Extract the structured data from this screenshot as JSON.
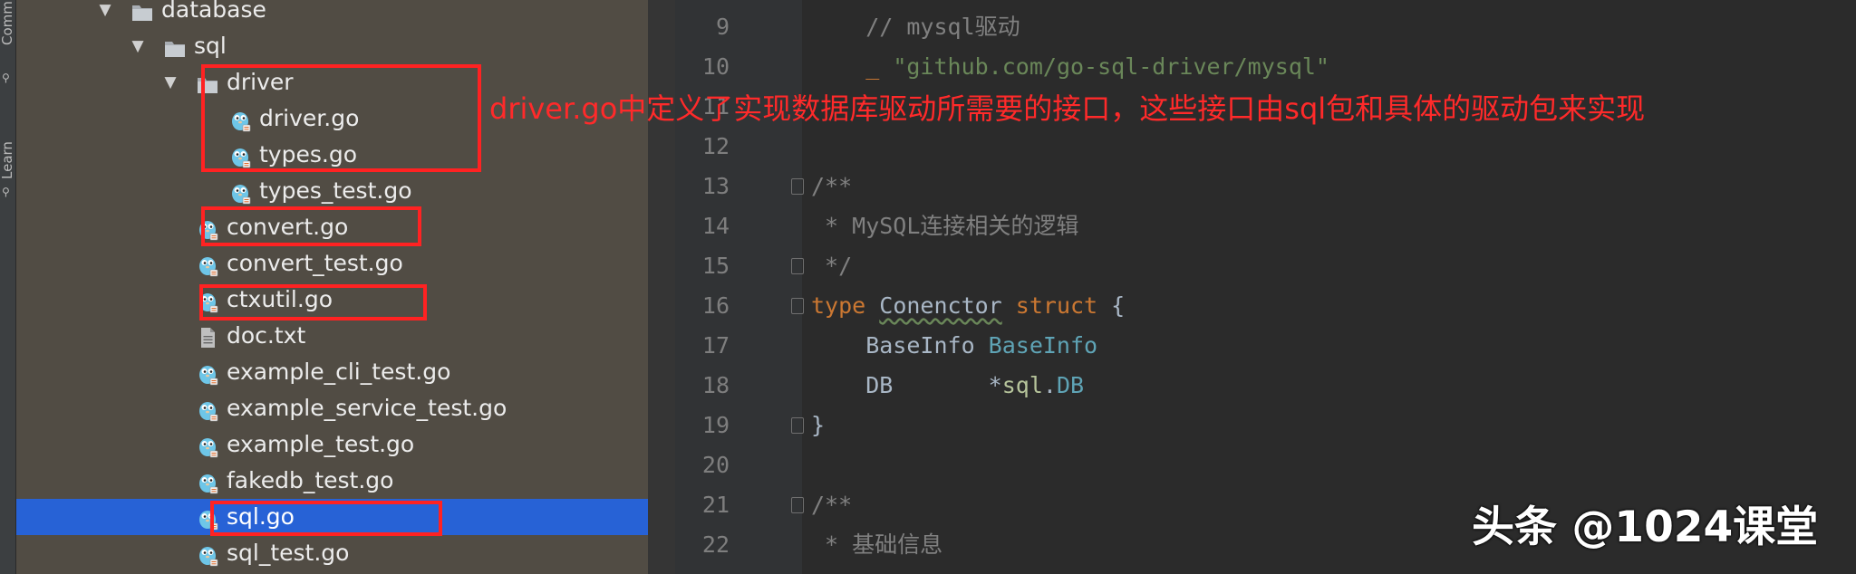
{
  "toolstrip": {
    "items": [
      {
        "label": "Commit",
        "icon": "commit-icon"
      },
      {
        "label": "Learn",
        "icon": "learn-icon"
      }
    ]
  },
  "tree": {
    "rows": [
      {
        "label": "database",
        "kind": "folder",
        "expanded": true,
        "depth": 0
      },
      {
        "label": "sql",
        "kind": "folder",
        "expanded": true,
        "depth": 1
      },
      {
        "label": "driver",
        "kind": "folder",
        "expanded": true,
        "depth": 2
      },
      {
        "label": "driver.go",
        "kind": "go-file",
        "depth": 3
      },
      {
        "label": "types.go",
        "kind": "go-file",
        "depth": 3
      },
      {
        "label": "types_test.go",
        "kind": "go-file",
        "depth": 3
      },
      {
        "label": "convert.go",
        "kind": "go-file",
        "depth": 2
      },
      {
        "label": "convert_test.go",
        "kind": "go-file",
        "depth": 2
      },
      {
        "label": "ctxutil.go",
        "kind": "go-file",
        "depth": 2
      },
      {
        "label": "doc.txt",
        "kind": "text-file",
        "depth": 2
      },
      {
        "label": "example_cli_test.go",
        "kind": "go-file",
        "depth": 2
      },
      {
        "label": "example_service_test.go",
        "kind": "go-file",
        "depth": 2
      },
      {
        "label": "example_test.go",
        "kind": "go-file",
        "depth": 2
      },
      {
        "label": "fakedb_test.go",
        "kind": "go-file",
        "depth": 2
      },
      {
        "label": "sql.go",
        "kind": "go-file",
        "depth": 2,
        "selected": true
      },
      {
        "label": "sql_test.go",
        "kind": "go-file",
        "depth": 2
      }
    ]
  },
  "editor": {
    "lines": [
      {
        "num": "9",
        "segments": [
          {
            "t": "    ",
            "c": "plain"
          },
          {
            "t": "// mysql驱动",
            "c": "comment"
          }
        ]
      },
      {
        "num": "10",
        "segments": [
          {
            "t": "    ",
            "c": "plain"
          },
          {
            "t": "_ ",
            "c": "kw"
          },
          {
            "t": "\"github.com/go-sql-driver/mysql\"",
            "c": "string"
          }
        ]
      },
      {
        "num": "11",
        "segments": []
      },
      {
        "num": "12",
        "segments": []
      },
      {
        "num": "13",
        "segments": [
          {
            "t": "/**",
            "c": "comment"
          }
        ],
        "fold": true
      },
      {
        "num": "14",
        "segments": [
          {
            "t": " * MySQL连接相关的逻辑",
            "c": "comment"
          }
        ]
      },
      {
        "num": "15",
        "segments": [
          {
            "t": " */",
            "c": "comment"
          }
        ],
        "fold": true
      },
      {
        "num": "16",
        "segments": [
          {
            "t": "type ",
            "c": "kw"
          },
          {
            "t": "Conenctor",
            "c": "plain",
            "underline": true
          },
          {
            "t": " struct ",
            "c": "kw"
          },
          {
            "t": "{",
            "c": "plain"
          }
        ],
        "fold": true
      },
      {
        "num": "17",
        "segments": [
          {
            "t": "    BaseInfo ",
            "c": "plain"
          },
          {
            "t": "BaseInfo",
            "c": "type"
          }
        ]
      },
      {
        "num": "18",
        "segments": [
          {
            "t": "    DB       *",
            "c": "plain"
          },
          {
            "t": "sql",
            "c": "pkg"
          },
          {
            "t": ".",
            "c": "plain"
          },
          {
            "t": "DB",
            "c": "type"
          }
        ]
      },
      {
        "num": "19",
        "segments": [
          {
            "t": "}",
            "c": "plain"
          }
        ],
        "fold": true
      },
      {
        "num": "20",
        "segments": []
      },
      {
        "num": "21",
        "segments": [
          {
            "t": "/**",
            "c": "comment"
          }
        ],
        "fold": true
      },
      {
        "num": "22",
        "segments": [
          {
            "t": " * 基础信息",
            "c": "comment"
          }
        ]
      }
    ]
  },
  "annotation": {
    "text": "driver.go中定义了实现数据库驱动所需要的接口，这些接口由sql包和具体的驱动包来实现",
    "color": "#ff2a2a"
  },
  "watermark": "头条 @1024课堂",
  "colors": {
    "tree_bg": "#514c44",
    "selection": "#2762d6",
    "editor_bg": "#2b2b2b",
    "highlight_box": "#ff2222"
  }
}
